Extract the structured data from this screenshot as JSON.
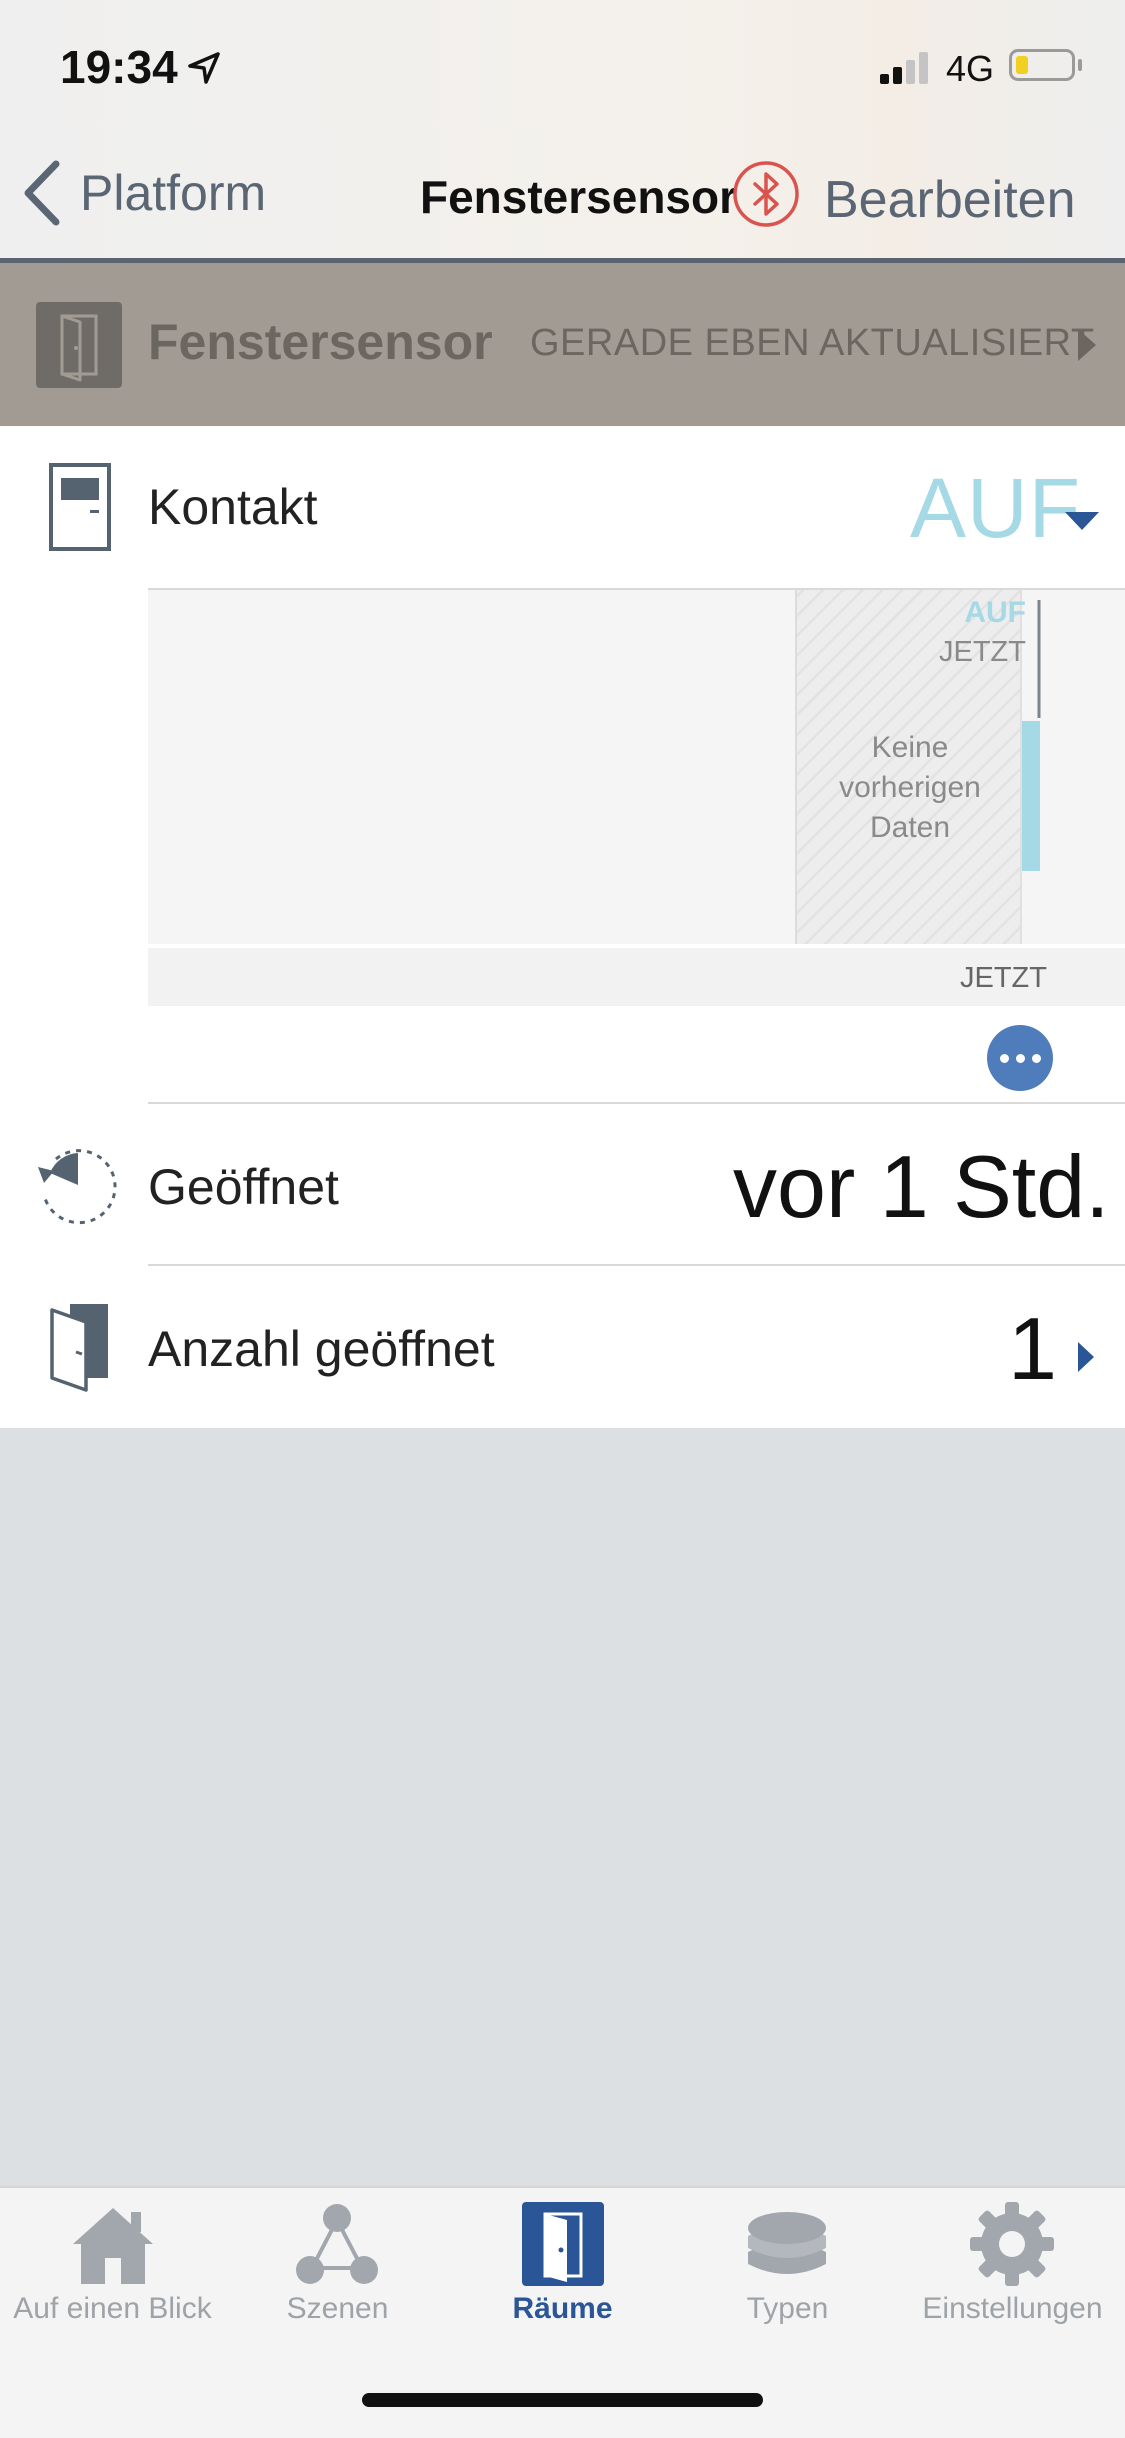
{
  "status": {
    "time": "19:34",
    "network": "4G"
  },
  "nav": {
    "back_label": "Platform",
    "title": "Fenstersensor",
    "edit_label": "Bearbeiten"
  },
  "device": {
    "name": "Fenstersensor",
    "status": "GERADE EBEN AKTUALISIERT"
  },
  "contact": {
    "label": "Kontakt",
    "value": "AUF",
    "chart": {
      "state_label": "AUF",
      "time_label": "JETZT",
      "no_data": "Keine vorherigen Daten",
      "axis_label": "JETZT"
    }
  },
  "opened": {
    "label": "Geöffnet",
    "value": "vor 1 Std."
  },
  "count": {
    "label": "Anzahl geöffnet",
    "value": "1"
  },
  "tabs": [
    {
      "label": "Auf einen Blick",
      "icon": "house-icon"
    },
    {
      "label": "Szenen",
      "icon": "scenes-icon"
    },
    {
      "label": "Räume",
      "icon": "door-icon"
    },
    {
      "label": "Typen",
      "icon": "layers-icon"
    },
    {
      "label": "Einstellungen",
      "icon": "gear-icon"
    }
  ],
  "colors": {
    "accent": "#2a5596",
    "contact_open": "#a6d9e6",
    "bluetooth": "#d9534f",
    "header_bg": "#a19b94"
  }
}
